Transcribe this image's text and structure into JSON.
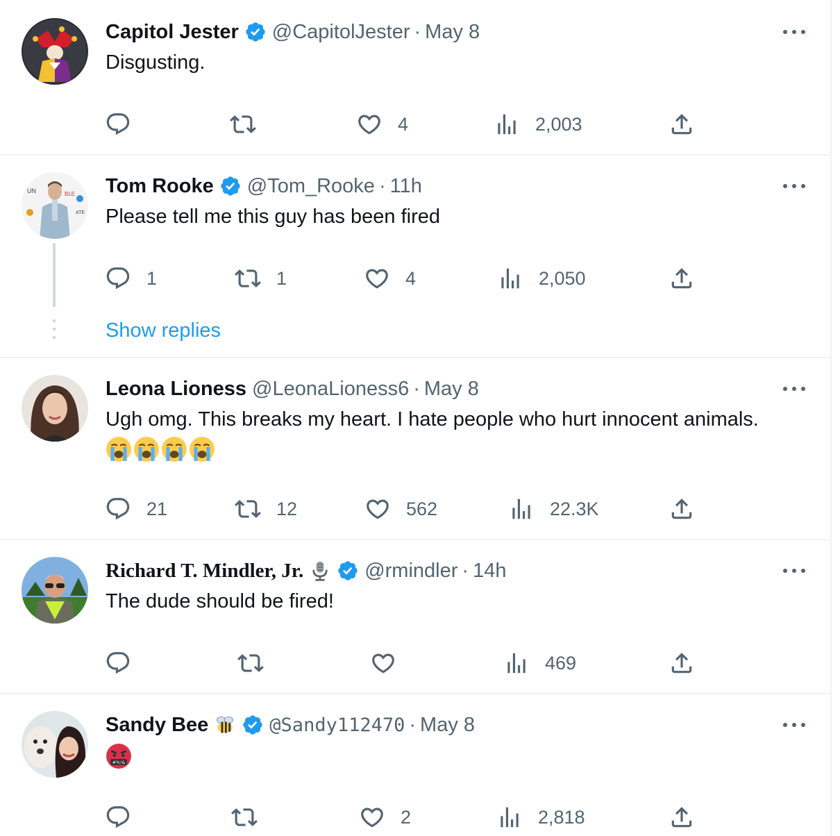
{
  "tweets": [
    {
      "name": "Capitol Jester",
      "handle": "@CapitolJester",
      "separator": "·",
      "time": "May 8",
      "verified": true,
      "text": "Disgusting.",
      "emojis": [],
      "avatar_icon": "jester-avatar",
      "reply_count": "",
      "retweet_count": "",
      "like_count": "4",
      "view_count": "2,003"
    },
    {
      "name": "Tom Rooke",
      "handle": "@Tom_Rooke",
      "separator": "·",
      "time": "11h",
      "verified": true,
      "text": "Please tell me this guy has been fired",
      "emojis": [],
      "avatar_icon": "man-at-event-avatar",
      "reply_count": "1",
      "retweet_count": "1",
      "like_count": "4",
      "view_count": "2,050",
      "show_replies": "Show replies"
    },
    {
      "name": "Leona Lioness",
      "handle": "@LeonaLioness6",
      "separator": "·",
      "time": "May 8",
      "verified": false,
      "text": "Ugh omg. This breaks my heart. I hate people who hurt innocent animals.",
      "emojis": [
        "loudly-crying-face-icon",
        "loudly-crying-face-icon",
        "loudly-crying-face-icon",
        "loudly-crying-face-icon"
      ],
      "avatar_icon": "woman-portrait-avatar",
      "reply_count": "21",
      "retweet_count": "12",
      "like_count": "562",
      "view_count": "22.3K"
    },
    {
      "name": "Richard T. Mindler, Jr.",
      "handle": "@rmindler",
      "separator": "·",
      "time": "14h",
      "verified": true,
      "name_emoji": "microphone-icon",
      "text": "The dude should be fired!",
      "emojis": [],
      "avatar_icon": "man-sunglasses-avatar",
      "reply_count": "",
      "retweet_count": "",
      "like_count": "",
      "view_count": "469"
    },
    {
      "name": "Sandy Bee",
      "handle": "@Sandy112470",
      "separator": "·",
      "time": "May 8",
      "verified": true,
      "name_emoji": "bee-icon",
      "text": "",
      "emojis": [
        "face-with-symbols-on-mouth-icon"
      ],
      "avatar_icon": "woman-with-dog-avatar",
      "reply_count": "",
      "retweet_count": "",
      "like_count": "2",
      "view_count": "2,818"
    }
  ],
  "colors": {
    "verified_blue": "#1d9bf0",
    "secondary_text": "#536471",
    "link_blue": "#1d9bf0",
    "divider": "#eff3f4"
  },
  "emoji_symbols": "#%!&"
}
